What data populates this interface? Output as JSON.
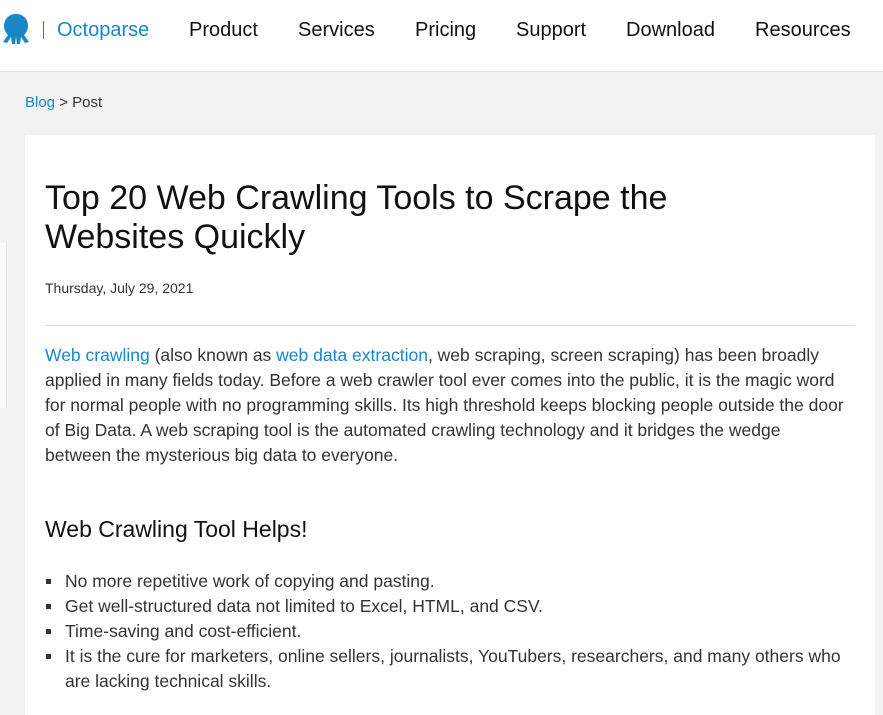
{
  "header": {
    "brand": "Octoparse",
    "nav": [
      "Product",
      "Services",
      "Pricing",
      "Support",
      "Download",
      "Resources"
    ],
    "accent_color": "#1a86c8"
  },
  "breadcrumb": {
    "blog": "Blog",
    "separator": ">",
    "current": "Post"
  },
  "article": {
    "title": "Top 20 Web Crawling Tools to Scrape the Websites Quickly",
    "date": "Thursday, July 29, 2021",
    "intro": {
      "link1": "Web crawling",
      "text1": " (also known as ",
      "link2": "web data extraction",
      "text2": ", web scraping, screen scraping) has been broadly applied in many fields today. Before a web crawler tool ever comes into the public, it is the magic word for normal people with no programming skills. Its high threshold keeps blocking people outside the door of Big Data. A web scraping tool is the automated crawling technology and it bridges the wedge between the mysterious big data to everyone."
    },
    "subheading": "Web Crawling Tool Helps!",
    "bullets": [
      "No more repetitive work of copying and pasting.",
      "Get well-structured data not limited to Excel, HTML, and CSV.",
      "Time-saving and cost-efficient.",
      "It is the cure for marketers, online sellers, journalists, YouTubers, researchers, and many others who are lacking technical skills."
    ]
  }
}
